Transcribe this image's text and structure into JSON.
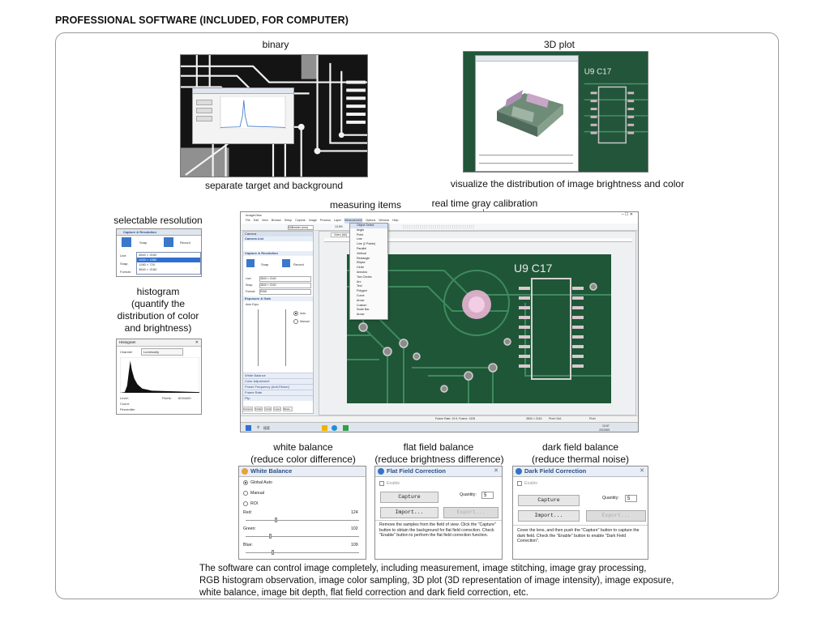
{
  "page_title": "PROFESSIONAL SOFTWARE (INCLUDED, FOR COMPUTER)",
  "captions": {
    "binary_title": "binary",
    "binary_sub": "separate target and background",
    "plot_title": "3D plot",
    "plot_sub": "visualize the distribution of image brightness and color",
    "measuring": "measuring items",
    "gray_cal": "real time gray calibration",
    "resolution": "selectable resolution",
    "histogram_1": "histogram",
    "histogram_2": "(quantify the",
    "histogram_3": "distribution of color",
    "histogram_4": "and brightness)",
    "wb_1": "white balance",
    "wb_2": "(reduce color difference)",
    "ff_1": "flat field balance",
    "ff_2": "(reduce brightness difference)",
    "df_1": "dark field balance",
    "df_2": "(reduce thermal noise)"
  },
  "description": [
    "The software can control image completely, including measurement, image stitching, image gray processing,",
    "RGB histogram observation, image color sampling, 3D plot (3D representation of image intensity), image exposure,",
    "white balance, image bit depth, flat field correction and dark field correction, etc."
  ],
  "app": {
    "title": "ImageView",
    "menu": [
      "File",
      "Edit",
      "View",
      "Browse",
      "Setup",
      "Capture",
      "Image",
      "Process",
      "Layer",
      "Measurement",
      "Options",
      "Window",
      "Help"
    ],
    "unit": "Millimeter (mm)",
    "zoom": "13.5%",
    "tab_left": "Camera",
    "tab_video": "Video [##]",
    "sidebar_sections": [
      "Camera List",
      "Capture & Resolution",
      "Exposure & Gain",
      "White Balance",
      "Color Adjustment",
      "Power Frequency (Anti-Flicker)",
      "Frame Rate",
      "Flip"
    ],
    "live_button": "Snap",
    "record_button": "Record",
    "res_values": [
      "3840 × 2160",
      "3840 × 2160",
      "RAW"
    ],
    "res_labels": [
      "Live:",
      "Snap:",
      "Format:"
    ],
    "auto_expo": "Auto Expo",
    "exposure_labels": [
      "Auto",
      "Manual"
    ],
    "measure_menu": [
      "Object Select",
      "Angle",
      "Point",
      "Line",
      "Line (2 Points)",
      "Parallel",
      "Vertical",
      "Rectangle",
      "Ellipse",
      "Circle",
      "Annulus",
      "Two Circles",
      "Arc",
      "Text",
      "Polygon",
      "Curve",
      "Arrow",
      "Custom",
      "Scale Bar",
      "Arrow"
    ],
    "status_frame": "Frame Rate: 19.9, Frame: 1328",
    "status_res": "3840 × 2160",
    "status_pixel": "Pixel: N/A",
    "status_unit": "Pixel",
    "taskbar_search": "搜索",
    "time": "10:57",
    "date": "2023/8/1",
    "pcb_label": "U9 C17",
    "bottom_tabs": [
      "Camera",
      "Folder",
      "Undo",
      "Layer",
      "Meas..."
    ],
    "bottom_tabs2": [
      "Measurement Sheet",
      "Segmentation Layer",
      "Histogram"
    ]
  },
  "resolution_panel": {
    "title": "Capture & Resolution",
    "snap": "Snap",
    "record": "Record",
    "labels": [
      "Live:",
      "Snap:",
      "Format:"
    ],
    "options": [
      "3840 × 2160",
      "1920 × 1080",
      "1280 × 720",
      "3840 × 2160"
    ],
    "format": "RGB24"
  },
  "histogram_panel": {
    "title": "Histogram",
    "channel_label": "Channel",
    "channel_value": "Luminosity",
    "stats": [
      "Level:",
      "Count:",
      "Percentile:"
    ],
    "pixels_label": "Pixels:",
    "pixels_value": "8294400"
  },
  "white_balance": {
    "title": "White Balance",
    "options": [
      "Global Auto",
      "Manual",
      "ROI"
    ],
    "selected": "Global Auto",
    "channels": [
      {
        "label": "Red:",
        "value": "124",
        "level": 0.26
      },
      {
        "label": "Green:",
        "value": "102",
        "level": 0.21
      },
      {
        "label": "Blue:",
        "value": "109",
        "level": 0.23
      }
    ]
  },
  "flat_field": {
    "title": "Flat Field Correction",
    "enable": "Enable",
    "capture": "Capture",
    "import": "Import...",
    "export": "Export...",
    "quantity_label": "Quantity:",
    "quantity": "5",
    "text": "Remove the samples from the field of view. Click the \"Capture\" button to obtain the background for flat field correction. Check \"Enable\" button to perform the flat field correction function."
  },
  "dark_field": {
    "title": "Dark Field Correction",
    "enable": "Enable",
    "capture": "Capture",
    "import": "Import...",
    "export": "Export...",
    "quantity_label": "Quantity:",
    "quantity": "5",
    "text": "Cover the lens, and then push the \"Capture\" button to capture the dark field. Check the \"Enable\" button to enable \"Dark Field Correction\"."
  },
  "colors": {
    "pcb_green": "#245c3c",
    "trace": "#3f8a5e",
    "pad": "#cfc7c9",
    "accent_blue": "#2b4f86",
    "pink_spot": "#e9b6d4"
  }
}
